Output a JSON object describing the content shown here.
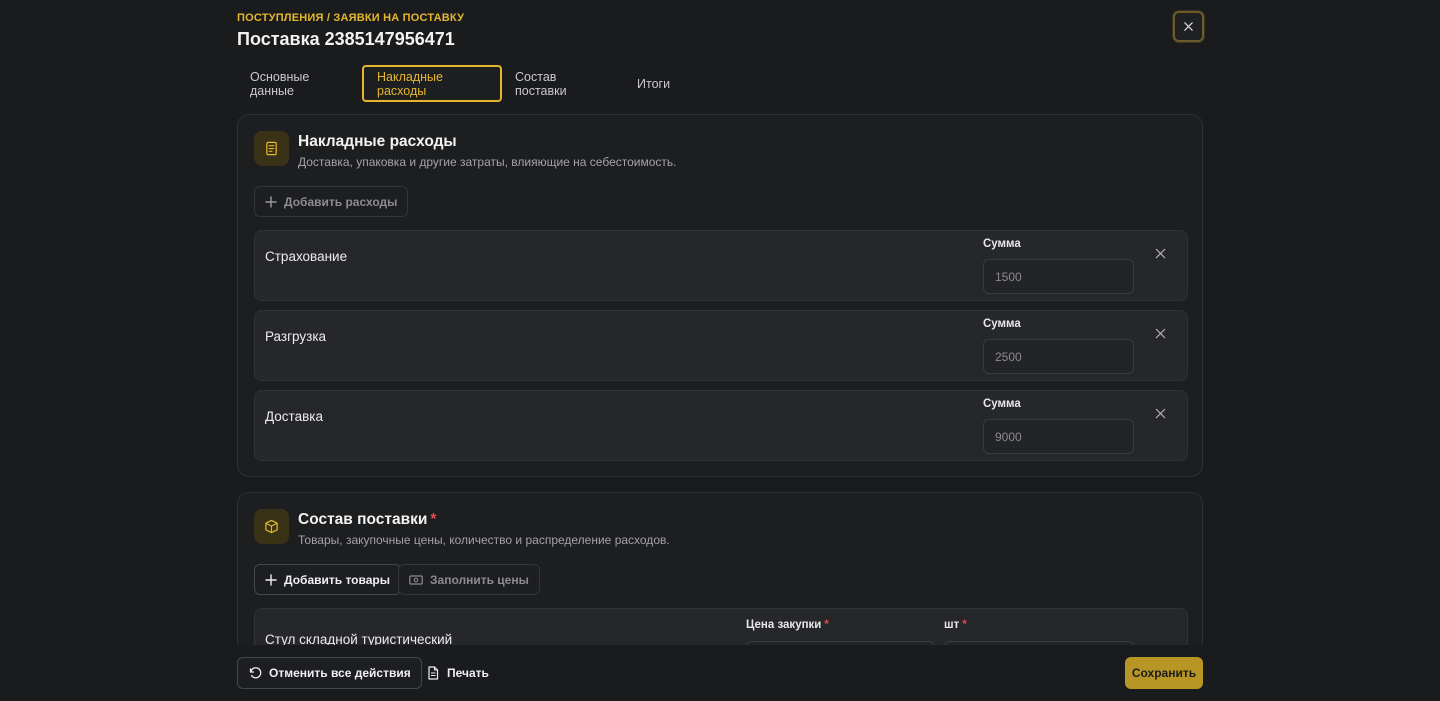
{
  "header": {
    "breadcrumb": "ПОСТУПЛЕНИЯ / ЗАЯВКИ НА ПОСТАВКУ",
    "title": "Поставка 2385147956471"
  },
  "tabs": [
    {
      "label": "Основные данные",
      "active": false
    },
    {
      "label": "Накладные расходы",
      "active": true
    },
    {
      "label": "Состав поставки",
      "active": false
    },
    {
      "label": "Итоги",
      "active": false
    }
  ],
  "overhead": {
    "icon": "receipt-icon",
    "title": "Накладные расходы",
    "subtitle": "Доставка, упаковка и другие затраты, влияющие на себестоимость.",
    "add_label": "Добавить расходы",
    "sum_label": "Сумма",
    "items": [
      {
        "name": "Страхование",
        "amount": "1500"
      },
      {
        "name": "Разгрузка",
        "amount": "2500"
      },
      {
        "name": "Доставка",
        "amount": "9000"
      }
    ]
  },
  "composition": {
    "icon": "package-icon",
    "title": "Состав поставки",
    "required": "*",
    "subtitle": "Товары, закупочные цены, количество и распределение расходов.",
    "add_label": "Добавить товары",
    "fill_label": "Заполнить цены",
    "product": {
      "name": "Стул складной туристический",
      "price_label": "Цена закупки",
      "qty_label": "шт"
    }
  },
  "footer": {
    "undo_label": "Отменить все действия",
    "print_label": "Печать",
    "save_label": "Сохранить"
  },
  "colors": {
    "accent": "#e6b72e",
    "background": "#1a1b1d",
    "required": "#e5484d"
  }
}
